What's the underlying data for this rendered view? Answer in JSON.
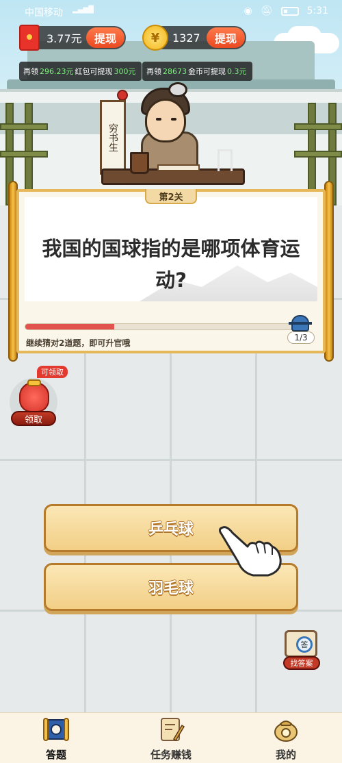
{
  "status_bar": {
    "carrier": "中国移动",
    "time": "5:31"
  },
  "wallet": {
    "cash_value": "3.77元",
    "cash_withdraw_label": "提现",
    "coin_symbol": "¥",
    "coin_value": "1327",
    "coin_withdraw_label": "提现"
  },
  "progress_tips": {
    "cash_prefix": "再领",
    "cash_amount": "296.23元",
    "cash_middle": "红包可提现",
    "cash_target": "300元",
    "coin_prefix": "再领",
    "coin_amount": "28673",
    "coin_middle": "金币可提现",
    "coin_target": "0.3元"
  },
  "character": {
    "sign_text": "穷书生"
  },
  "quiz": {
    "level_label": "第2关",
    "question": "我国的国球指的是哪项体育运动?",
    "progress_fraction": 0.33,
    "progress_count": "1/3",
    "hint": "继续猜对2道题，即可升官哦"
  },
  "reward_bag": {
    "tag": "可领取",
    "button_label": "领取"
  },
  "answers": [
    {
      "label": "乒乓球"
    },
    {
      "label": "羽毛球"
    }
  ],
  "find_answer": {
    "glass_char": "答",
    "label": "找答案"
  },
  "nav": {
    "items": [
      {
        "label": "答题",
        "icon": "scroll-icon"
      },
      {
        "label": "任务赚钱",
        "icon": "task-pen-icon"
      },
      {
        "label": "我的",
        "icon": "money-bag-icon"
      }
    ],
    "active_index": 0
  },
  "colors": {
    "accent_red": "#e94a22",
    "gold": "#e6b85a",
    "progress_red": "#e2534d"
  }
}
